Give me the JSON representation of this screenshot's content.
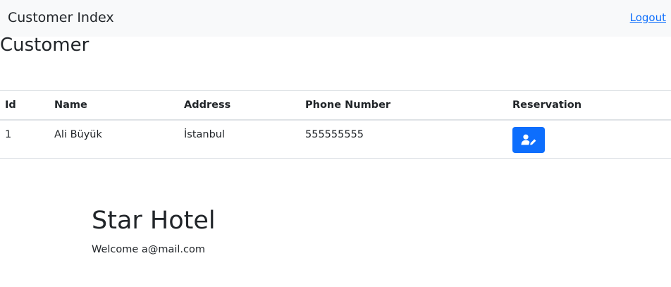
{
  "navbar": {
    "brand": "Customer Index",
    "logout_label": "Logout"
  },
  "page": {
    "title": "Customer"
  },
  "table": {
    "headers": [
      "Id",
      "Name",
      "Address",
      "Phone Number",
      "Reservation"
    ],
    "rows": [
      {
        "id": "1",
        "name": "Ali Büyük",
        "address": "İstanbul",
        "phone": "555555555",
        "reservation_icon": "user-edit-icon"
      }
    ]
  },
  "hero": {
    "title": "Star Hotel",
    "welcome": "Welcome a@mail.com"
  },
  "colors": {
    "navbar_bg": "#f8f9fa",
    "primary": "#0d6efd",
    "text": "#212529",
    "border": "#dee2e6"
  }
}
